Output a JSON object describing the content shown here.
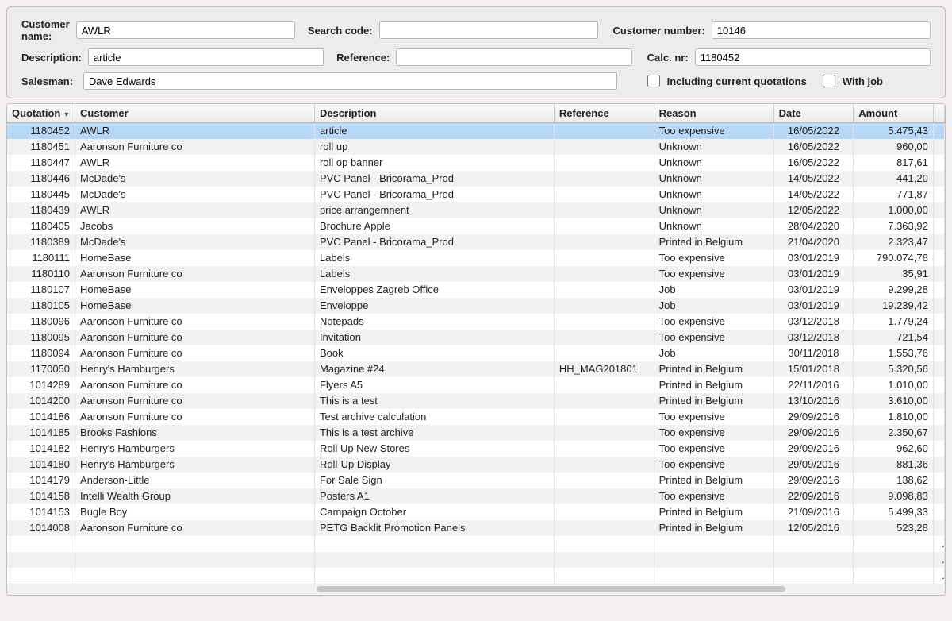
{
  "filters": {
    "customer_name_label": "Customer name:",
    "customer_name_value": "AWLR",
    "description_label": "Description:",
    "description_value": "article",
    "salesman_label": "Salesman:",
    "salesman_value": "Dave Edwards",
    "search_code_label": "Search code:",
    "search_code_value": "",
    "reference_label": "Reference:",
    "reference_value": "",
    "customer_number_label": "Customer number:",
    "customer_number_value": "10146",
    "calc_nr_label": "Calc. nr:",
    "calc_nr_value": "1180452",
    "including_current_label": "Including current quotations",
    "with_job_label": "With job"
  },
  "columns": {
    "quotation": "Quotation",
    "customer": "Customer",
    "description": "Description",
    "reference": "Reference",
    "reason": "Reason",
    "date": "Date",
    "amount": "Amount"
  },
  "sort": {
    "column": "quotation",
    "dir": "desc"
  },
  "rows": [
    {
      "quotation": "1180452",
      "customer": "AWLR",
      "description": "article",
      "reference": "",
      "reason": "Too expensive",
      "date": "16/05/2022",
      "amount": "5.475,43",
      "selected": true
    },
    {
      "quotation": "1180451",
      "customer": "Aaronson Furniture co",
      "description": "roll up",
      "reference": "",
      "reason": "Unknown",
      "date": "16/05/2022",
      "amount": "960,00"
    },
    {
      "quotation": "1180447",
      "customer": "AWLR",
      "description": "roll op banner",
      "reference": "",
      "reason": "Unknown",
      "date": "16/05/2022",
      "amount": "817,61"
    },
    {
      "quotation": "1180446",
      "customer": "McDade's",
      "description": "PVC Panel - Bricorama_Prod",
      "reference": "",
      "reason": "Unknown",
      "date": "14/05/2022",
      "amount": "441,20"
    },
    {
      "quotation": "1180445",
      "customer": "McDade's",
      "description": "PVC Panel - Bricorama_Prod",
      "reference": "",
      "reason": "Unknown",
      "date": "14/05/2022",
      "amount": "771,87"
    },
    {
      "quotation": "1180439",
      "customer": "AWLR",
      "description": "price arrangemnent",
      "reference": "",
      "reason": "Unknown",
      "date": "12/05/2022",
      "amount": "1.000,00"
    },
    {
      "quotation": "1180405",
      "customer": "Jacobs",
      "description": "Brochure Apple",
      "reference": "",
      "reason": "Unknown",
      "date": "28/04/2020",
      "amount": "7.363,92"
    },
    {
      "quotation": "1180389",
      "customer": "McDade's",
      "description": "PVC Panel - Bricorama_Prod",
      "reference": "",
      "reason": "Printed in Belgium",
      "date": "21/04/2020",
      "amount": "2.323,47"
    },
    {
      "quotation": "1180111",
      "customer": "HomeBase",
      "description": "Labels",
      "reference": "",
      "reason": "Too expensive",
      "date": "03/01/2019",
      "amount": "790.074,78"
    },
    {
      "quotation": "1180110",
      "customer": "Aaronson Furniture co",
      "description": "Labels",
      "reference": "",
      "reason": "Too expensive",
      "date": "03/01/2019",
      "amount": "35,91"
    },
    {
      "quotation": "1180107",
      "customer": "HomeBase",
      "description": "Enveloppes Zagreb Office",
      "reference": "",
      "reason": "Job",
      "date": "03/01/2019",
      "amount": "9.299,28"
    },
    {
      "quotation": "1180105",
      "customer": "HomeBase",
      "description": "Enveloppe",
      "reference": "",
      "reason": "Job",
      "date": "03/01/2019",
      "amount": "19.239,42"
    },
    {
      "quotation": "1180096",
      "customer": "Aaronson Furniture co",
      "description": "Notepads",
      "reference": "",
      "reason": "Too expensive",
      "date": "03/12/2018",
      "amount": "1.779,24"
    },
    {
      "quotation": "1180095",
      "customer": "Aaronson Furniture co",
      "description": "Invitation",
      "reference": "",
      "reason": "Too expensive",
      "date": "03/12/2018",
      "amount": "721,54"
    },
    {
      "quotation": "1180094",
      "customer": "Aaronson Furniture co",
      "description": "Book",
      "reference": "",
      "reason": "Job",
      "date": "30/11/2018",
      "amount": "1.553,76"
    },
    {
      "quotation": "1170050",
      "customer": "Henry's Hamburgers",
      "description": "Magazine #24",
      "reference": "HH_MAG201801",
      "reason": "Printed in Belgium",
      "date": "15/01/2018",
      "amount": "5.320,56"
    },
    {
      "quotation": "1014289",
      "customer": "Aaronson Furniture co",
      "description": "Flyers A5",
      "reference": "",
      "reason": "Printed in Belgium",
      "date": "22/11/2016",
      "amount": "1.010,00"
    },
    {
      "quotation": "1014200",
      "customer": "Aaronson Furniture co",
      "description": "This is a test",
      "reference": "",
      "reason": "Printed in Belgium",
      "date": "13/10/2016",
      "amount": "3.610,00"
    },
    {
      "quotation": "1014186",
      "customer": "Aaronson Furniture co",
      "description": "Test archive calculation",
      "reference": "",
      "reason": "Too expensive",
      "date": "29/09/2016",
      "amount": "1.810,00"
    },
    {
      "quotation": "1014185",
      "customer": "Brooks Fashions",
      "description": "This is a test archive",
      "reference": "",
      "reason": "Too expensive",
      "date": "29/09/2016",
      "amount": "2.350,67"
    },
    {
      "quotation": "1014182",
      "customer": "Henry's Hamburgers",
      "description": "Roll Up New Stores",
      "reference": "",
      "reason": "Too expensive",
      "date": "29/09/2016",
      "amount": "962,60"
    },
    {
      "quotation": "1014180",
      "customer": "Henry's Hamburgers",
      "description": "Roll-Up Display",
      "reference": "",
      "reason": "Too expensive",
      "date": "29/09/2016",
      "amount": "881,36"
    },
    {
      "quotation": "1014179",
      "customer": "Anderson-Little",
      "description": "For Sale Sign",
      "reference": "",
      "reason": "Printed in Belgium",
      "date": "29/09/2016",
      "amount": "138,62"
    },
    {
      "quotation": "1014158",
      "customer": "Intelli Wealth Group",
      "description": "Posters A1",
      "reference": "",
      "reason": "Too expensive",
      "date": "22/09/2016",
      "amount": "9.098,83"
    },
    {
      "quotation": "1014153",
      "customer": "Bugle Boy",
      "description": "Campaign October",
      "reference": "",
      "reason": "Printed in Belgium",
      "date": "21/09/2016",
      "amount": "5.499,33"
    },
    {
      "quotation": "1014008",
      "customer": "Aaronson Furniture co",
      "description": "PETG Backlit Promotion Panels",
      "reference": "",
      "reason": "Printed in Belgium",
      "date": "12/05/2016",
      "amount": "523,28"
    }
  ],
  "blank_rows": 3
}
